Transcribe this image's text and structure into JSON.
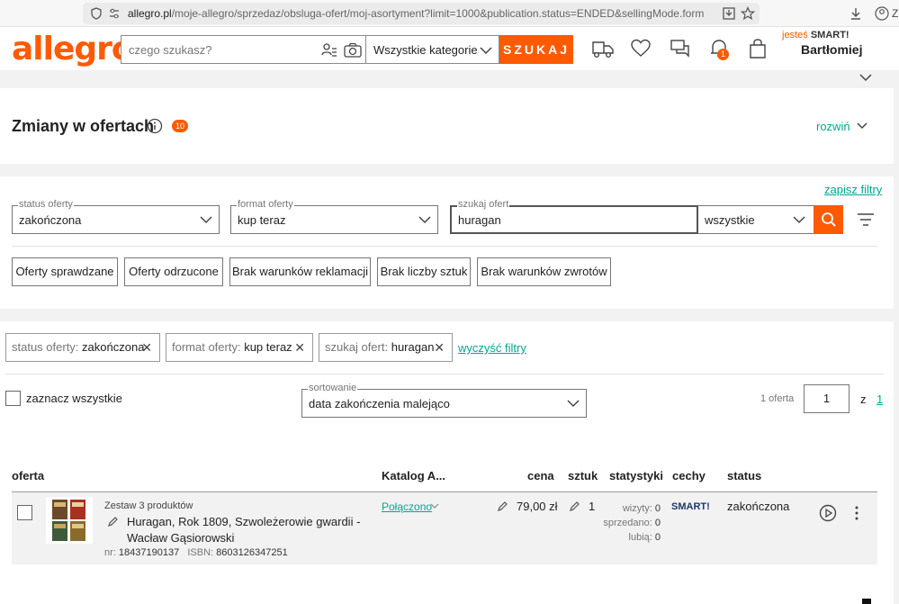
{
  "browser": {
    "url_host": "allegro.pl",
    "url_path": "/moje-allegro/sprzedaz/obsluga-ofert/moj-asortyment?limit=1000&publication.status=ENDED&sellingMode.format=BUY_N"
  },
  "header": {
    "logo": "allegro",
    "search_placeholder": "czego szukasz?",
    "category": "Wszystkie kategorie",
    "search_button": "SZUKAJ",
    "notification_count": "1",
    "smart_prefix": "jesteś",
    "smart_label": "SMART!",
    "user_name": "Bartłomiej"
  },
  "changes": {
    "title": "Zmiany w ofertach",
    "count": "10",
    "expand": "rozwiń"
  },
  "filters": {
    "save": "zapisz filtry",
    "status": {
      "label": "status oferty",
      "value": "zakończona"
    },
    "format": {
      "label": "format oferty",
      "value": "kup teraz"
    },
    "search": {
      "label": "szukaj ofert",
      "value": "huragan"
    },
    "scope": "wszystkie",
    "quick": [
      "Oferty sprawdzane",
      "Oferty odrzucone",
      "Brak warunków reklamacji",
      "Brak liczby sztuk",
      "Brak warunków zwrotów"
    ]
  },
  "active_filters": {
    "chips": [
      {
        "key": "status oferty:",
        "value": "zakończona"
      },
      {
        "key": "format oferty:",
        "value": "kup teraz"
      },
      {
        "key": "szukaj ofert:",
        "value": "huragan"
      }
    ],
    "clear": "wyczyść filtry"
  },
  "list_controls": {
    "select_all": "zaznacz wszystkie",
    "sort_label": "sortowanie",
    "sort_value": "data zakończenia malejąco",
    "count": "1 oferta",
    "page": "1",
    "of": "z",
    "total_pages": "1"
  },
  "table": {
    "headers": {
      "offer": "oferta",
      "catalog": "Katalog A...",
      "price": "cena",
      "qty": "sztuk",
      "stats": "statystyki",
      "features": "cechy",
      "status": "status"
    },
    "row": {
      "set_label": "Zestaw 3 produktów",
      "title_line1": "Huragan, Rok 1809, Szwoleżerowie gwardii -",
      "title_line2": "Wacław Gąsiorowski",
      "nr_label": "nr:",
      "nr": "18437190137",
      "isbn_label": "ISBN:",
      "isbn": "8603126347251",
      "catalog": "Połączono",
      "price": "79,00 zł",
      "qty": "1",
      "visits_label": "wizyty:",
      "visits": "0",
      "sold_label": "sprzedano:",
      "sold": "0",
      "likes_label": "lubią:",
      "likes": "0",
      "feature": "SMART!",
      "status": "zakończona"
    }
  },
  "colors": {
    "accent": "#ff5a00",
    "link": "#00a790"
  }
}
